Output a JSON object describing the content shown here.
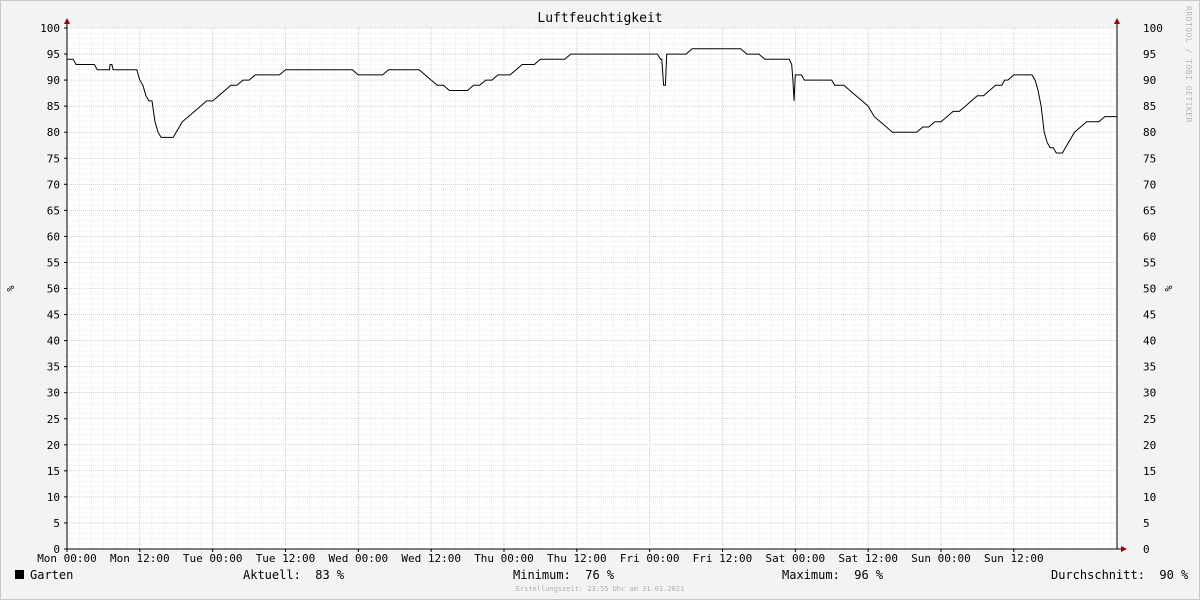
{
  "chart_data": {
    "type": "line",
    "title": "Luftfeuchtigkeit",
    "ylabel": "%",
    "ylim": [
      0,
      100
    ],
    "y_ticks": [
      "0",
      "5",
      "10",
      "15",
      "20",
      "25",
      "30",
      "35",
      "40",
      "45",
      "50",
      "55",
      "60",
      "65",
      "70",
      "75",
      "80",
      "85",
      "90",
      "95",
      "100"
    ],
    "x_tick_labels": [
      "Mon 00:00",
      "Mon 12:00",
      "Tue 00:00",
      "Tue 12:00",
      "Wed 00:00",
      "Wed 12:00",
      "Thu 00:00",
      "Thu 12:00",
      "Fri 00:00",
      "Fri 12:00",
      "Sat 00:00",
      "Sat 12:00",
      "Sun 00:00",
      "Sun 12:00"
    ],
    "x_range_hours": [
      0,
      168
    ],
    "grid": true,
    "series": [
      {
        "name": "Garten",
        "color": "#000000",
        "points": [
          [
            0,
            94
          ],
          [
            1,
            94
          ],
          [
            1.5,
            93
          ],
          [
            4.5,
            93
          ],
          [
            5,
            92
          ],
          [
            7,
            92
          ],
          [
            7.1,
            93
          ],
          [
            7.4,
            93
          ],
          [
            7.6,
            92
          ],
          [
            11.5,
            92
          ],
          [
            12,
            90
          ],
          [
            12.5,
            89
          ],
          [
            13,
            87
          ],
          [
            13.5,
            86
          ],
          [
            14,
            86
          ],
          [
            14.5,
            82
          ],
          [
            15,
            80
          ],
          [
            15.5,
            79
          ],
          [
            17.5,
            79
          ],
          [
            18,
            80
          ],
          [
            18.5,
            81
          ],
          [
            19,
            82
          ],
          [
            20,
            83
          ],
          [
            21,
            84
          ],
          [
            22,
            85
          ],
          [
            23,
            86
          ],
          [
            24,
            86
          ],
          [
            25,
            87
          ],
          [
            26,
            88
          ],
          [
            27,
            89
          ],
          [
            28,
            89
          ],
          [
            29,
            90
          ],
          [
            30,
            90
          ],
          [
            31,
            91
          ],
          [
            35,
            91
          ],
          [
            36,
            92
          ],
          [
            47,
            92
          ],
          [
            48,
            91
          ],
          [
            52,
            91
          ],
          [
            53,
            92
          ],
          [
            58,
            92
          ],
          [
            59,
            91
          ],
          [
            60,
            90
          ],
          [
            61,
            89
          ],
          [
            62,
            89
          ],
          [
            63,
            88
          ],
          [
            66,
            88
          ],
          [
            67,
            89
          ],
          [
            68,
            89
          ],
          [
            69,
            90
          ],
          [
            70,
            90
          ],
          [
            71,
            91
          ],
          [
            73,
            91
          ],
          [
            74,
            92
          ],
          [
            75,
            93
          ],
          [
            77,
            93
          ],
          [
            78,
            94
          ],
          [
            82,
            94
          ],
          [
            83,
            95
          ],
          [
            97,
            95
          ],
          [
            97.3,
            95
          ],
          [
            97.8,
            94
          ],
          [
            98,
            94
          ],
          [
            98.3,
            89
          ],
          [
            98.6,
            89
          ],
          [
            98.8,
            95
          ],
          [
            102,
            95
          ],
          [
            103,
            96
          ],
          [
            111,
            96
          ],
          [
            112,
            95
          ],
          [
            114,
            95
          ],
          [
            115,
            94
          ],
          [
            119,
            94
          ],
          [
            119.4,
            93
          ],
          [
            119.6,
            90
          ],
          [
            119.8,
            86
          ],
          [
            120,
            91
          ],
          [
            121,
            91
          ],
          [
            121.5,
            90
          ],
          [
            126,
            90
          ],
          [
            126.5,
            89
          ],
          [
            128,
            89
          ],
          [
            129,
            88
          ],
          [
            130,
            87
          ],
          [
            131,
            86
          ],
          [
            132,
            85
          ],
          [
            133,
            83
          ],
          [
            134,
            82
          ],
          [
            135,
            81
          ],
          [
            136,
            80
          ],
          [
            140,
            80
          ],
          [
            141,
            81
          ],
          [
            142,
            81
          ],
          [
            143,
            82
          ],
          [
            144,
            82
          ],
          [
            145,
            83
          ],
          [
            146,
            84
          ],
          [
            147,
            84
          ],
          [
            148,
            85
          ],
          [
            149,
            86
          ],
          [
            150,
            87
          ],
          [
            151,
            87
          ],
          [
            152,
            88
          ],
          [
            153,
            89
          ],
          [
            154,
            89
          ],
          [
            154.5,
            90
          ],
          [
            155,
            90
          ],
          [
            156,
            91
          ],
          [
            159,
            91
          ],
          [
            159.5,
            90
          ],
          [
            160,
            88
          ],
          [
            160.5,
            85
          ],
          [
            161,
            80
          ],
          [
            161.5,
            78
          ],
          [
            162,
            77
          ],
          [
            162.5,
            77
          ],
          [
            163,
            76
          ],
          [
            164,
            76
          ],
          [
            164.5,
            77
          ],
          [
            165,
            78
          ],
          [
            165.5,
            79
          ],
          [
            166,
            80
          ],
          [
            167,
            81
          ],
          [
            168,
            82
          ],
          [
            170,
            82
          ],
          [
            171,
            83
          ],
          [
            173,
            83
          ]
        ]
      }
    ]
  },
  "legend": {
    "series_name": "Garten",
    "aktuell_label": "Aktuell:",
    "aktuell_value": "83 %",
    "minimum_label": "Minimum:",
    "minimum_value": "76 %",
    "maximum_label": "Maximum:",
    "maximum_value": "96 %",
    "durchschnitt_label": "Durchschnitt:",
    "durchschnitt_value": "90 %"
  },
  "watermark": "RRDTOOL / TOBI OETIKER",
  "footer": "Erstellungszeit: 23:55 Uhr am 31.01.2021"
}
